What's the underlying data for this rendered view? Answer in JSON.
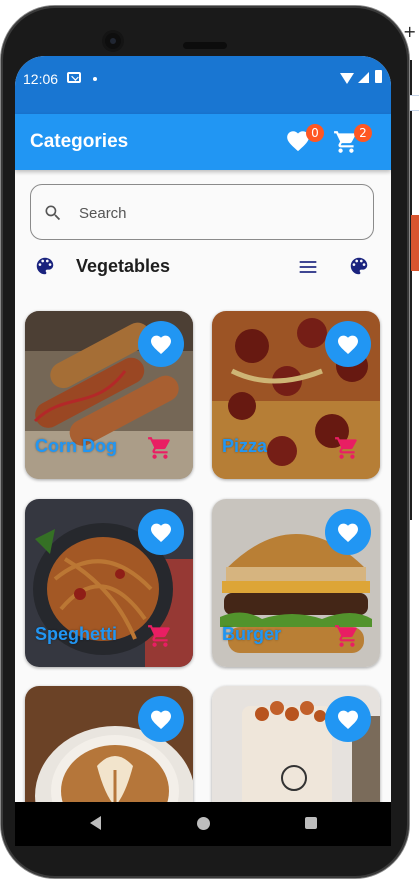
{
  "status_bar": {
    "time": "12:06",
    "icons": [
      "mail-icon",
      "dot-icon",
      "wifi-icon",
      "signal-icon",
      "battery-icon"
    ]
  },
  "app_bar": {
    "title": "Categories",
    "favorites_count": "0",
    "cart_count": "2",
    "colors": {
      "primary": "#2196f3",
      "status": "#1976d2",
      "badge": "#ff5722"
    }
  },
  "search": {
    "placeholder": "Search",
    "value": ""
  },
  "category_bar": {
    "title": "Vegetables",
    "left_icon": "palette-icon",
    "right_icons": [
      "menu-icon",
      "palette-icon"
    ]
  },
  "foods": [
    {
      "name": "Corn Dog"
    },
    {
      "name": "Pizza"
    },
    {
      "name": "Speghetti"
    },
    {
      "name": "Burger"
    },
    {
      "name": ""
    },
    {
      "name": ""
    }
  ],
  "colors": {
    "heart_button": "#2196f3",
    "cart_icon": "#e91e63",
    "food_label": "#2196f3"
  },
  "nav_bar": {
    "icons": [
      "back-icon",
      "home-icon",
      "recents-icon"
    ]
  }
}
